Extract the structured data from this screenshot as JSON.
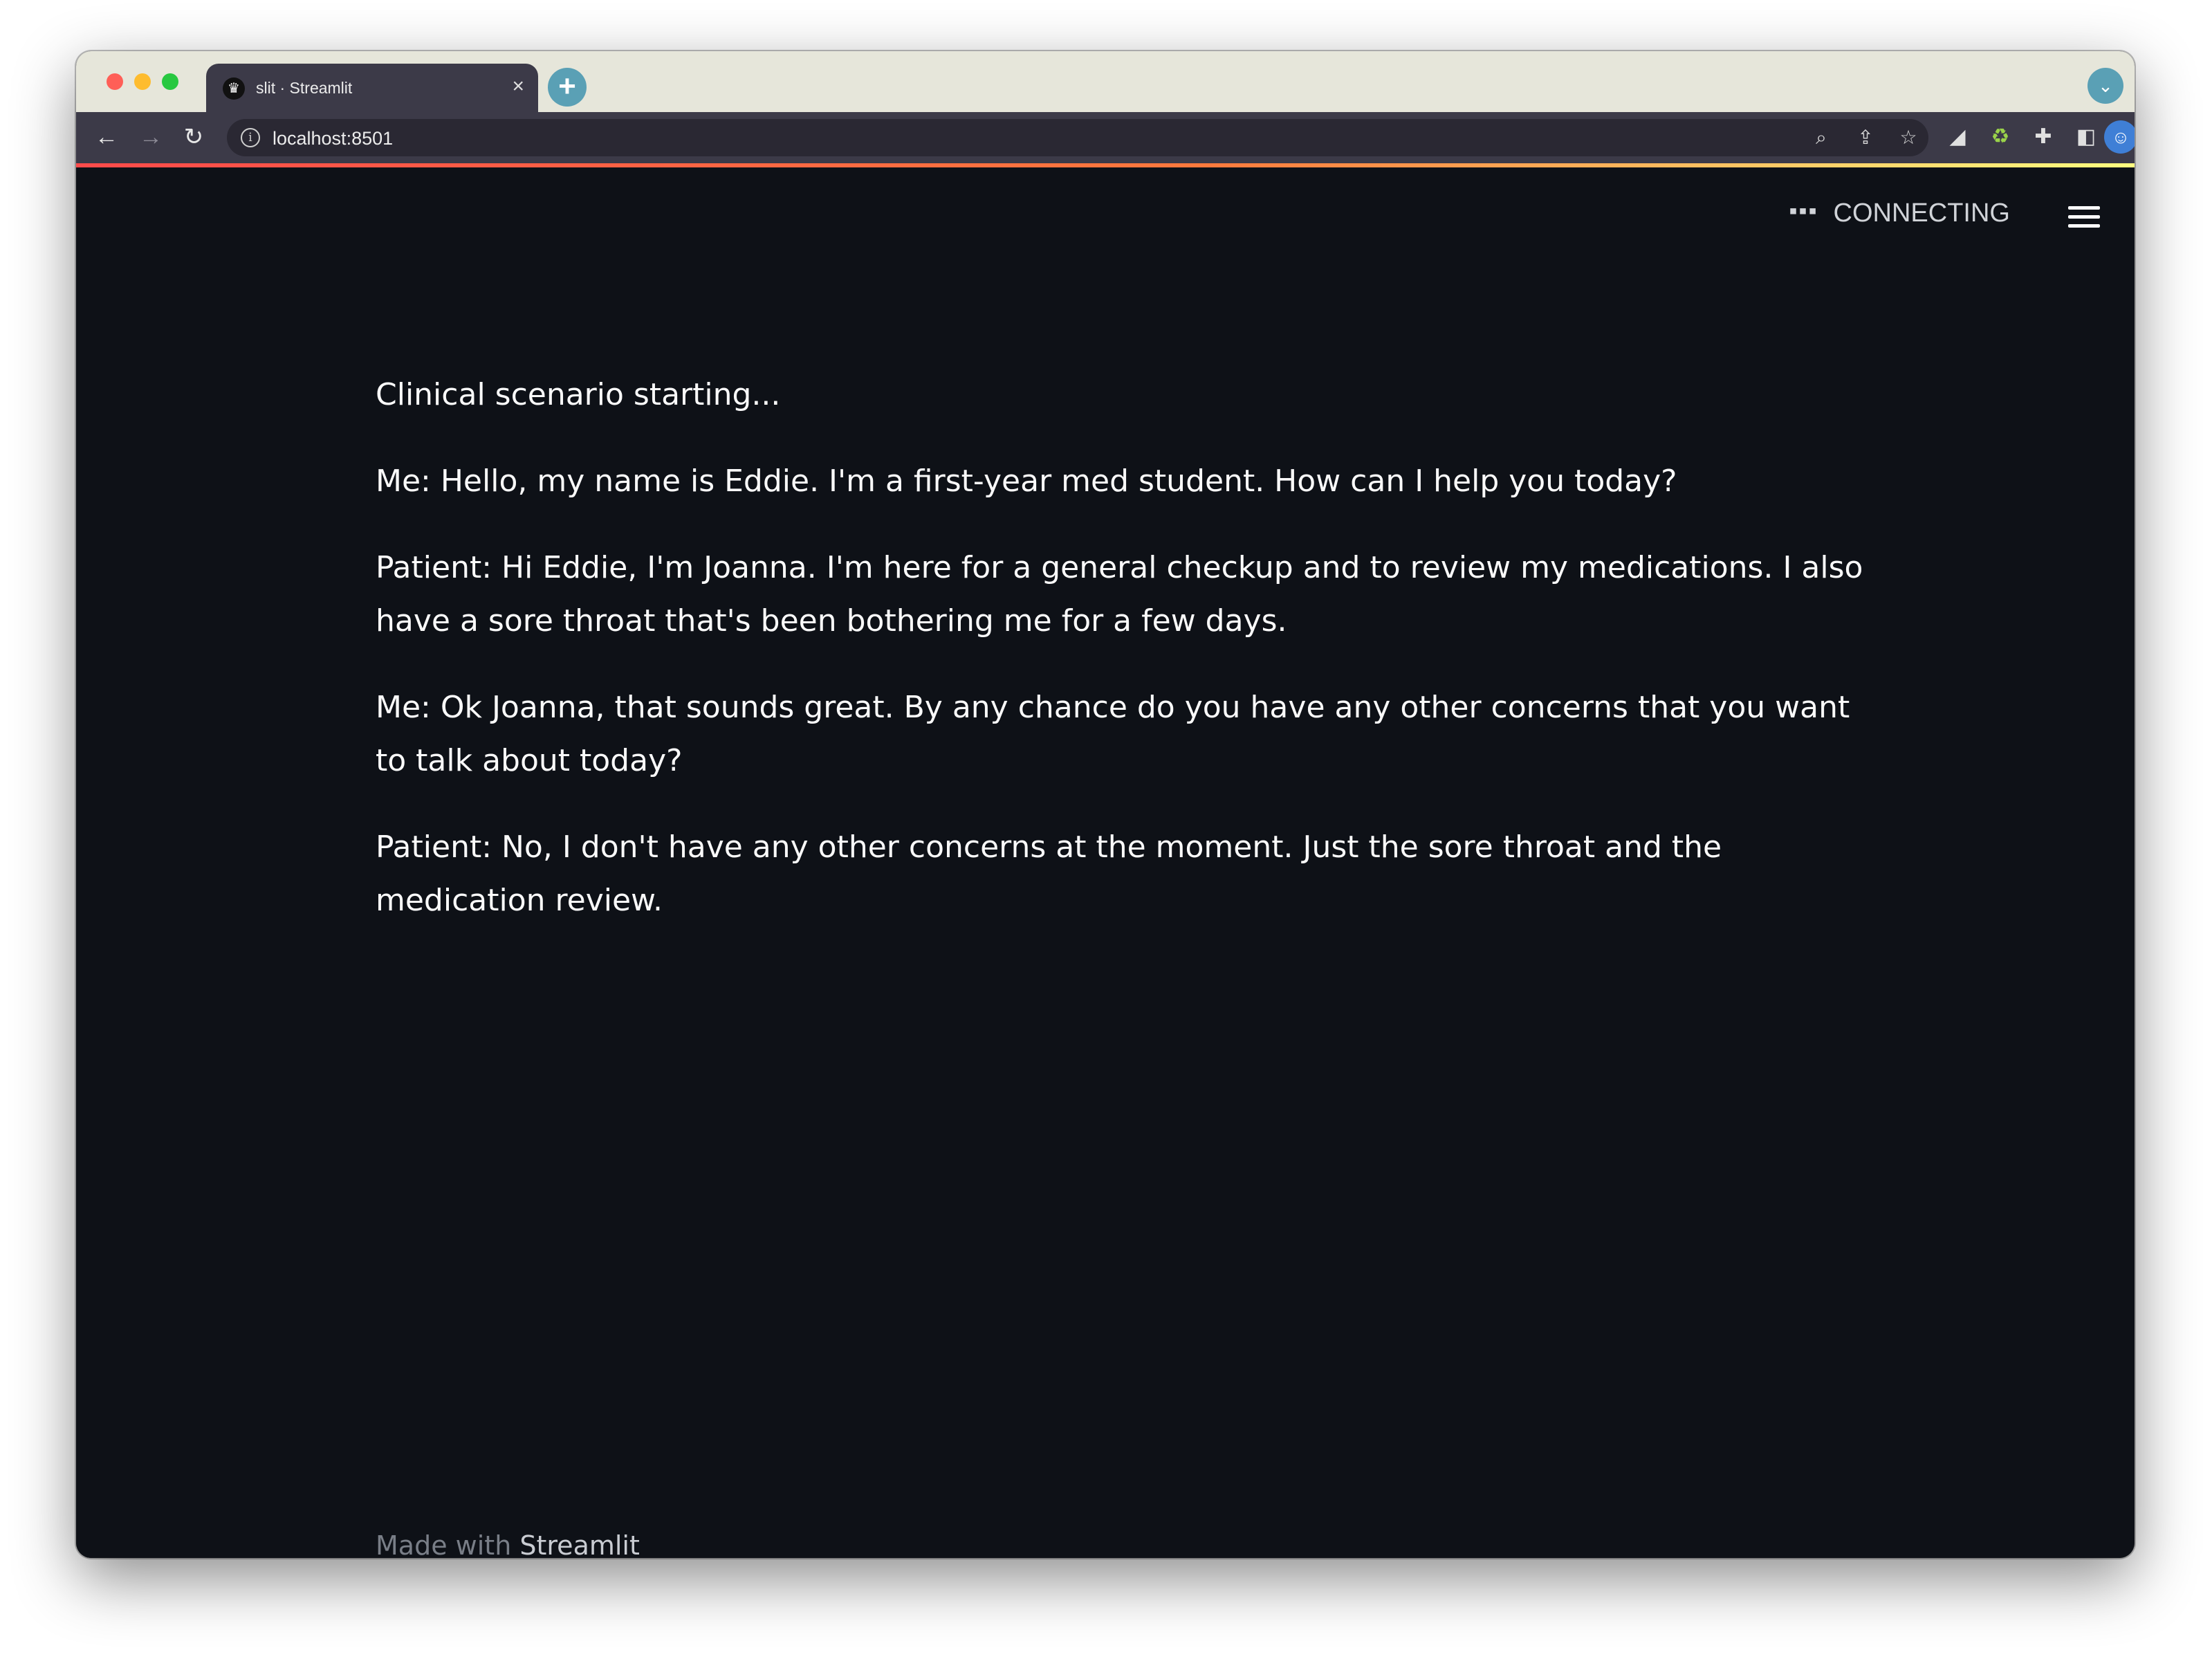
{
  "browser": {
    "tab_title": "slit · Streamlit",
    "tab_close": "×",
    "new_tab": "+",
    "url": "localhost:8501",
    "icons": {
      "back": "arrow-left",
      "forward": "arrow-right",
      "reload": "reload",
      "info": "info-circle",
      "zoom": "zoom",
      "share": "share",
      "bookmark": "star",
      "extensions": "puzzle",
      "sidepanel": "side-panel",
      "menu": "kebab"
    }
  },
  "app": {
    "status": "CONNECTING",
    "messages": [
      "Clinical scenario starting...",
      "Me: Hello, my name is Eddie. I'm a first-year med student. How can I help you today?",
      "Patient: Hi Eddie, I'm Joanna. I'm here for a general checkup and to review my medications. I also have a sore throat that's been bothering me for a few days.",
      "Me: Ok Joanna, that sounds great. By any chance do you have any other concerns that you want to talk about today?",
      "Patient: No, I don't have any other concerns at the moment. Just the sore throat and the medication review."
    ],
    "footer": {
      "prefix": "Made with",
      "brand": "Streamlit"
    }
  },
  "colors": {
    "background": "#0e1117",
    "text": "#fafafa",
    "accent": "#ff4b4b",
    "tab": "#3c3a48",
    "tabstrip": "#e6e6da"
  }
}
